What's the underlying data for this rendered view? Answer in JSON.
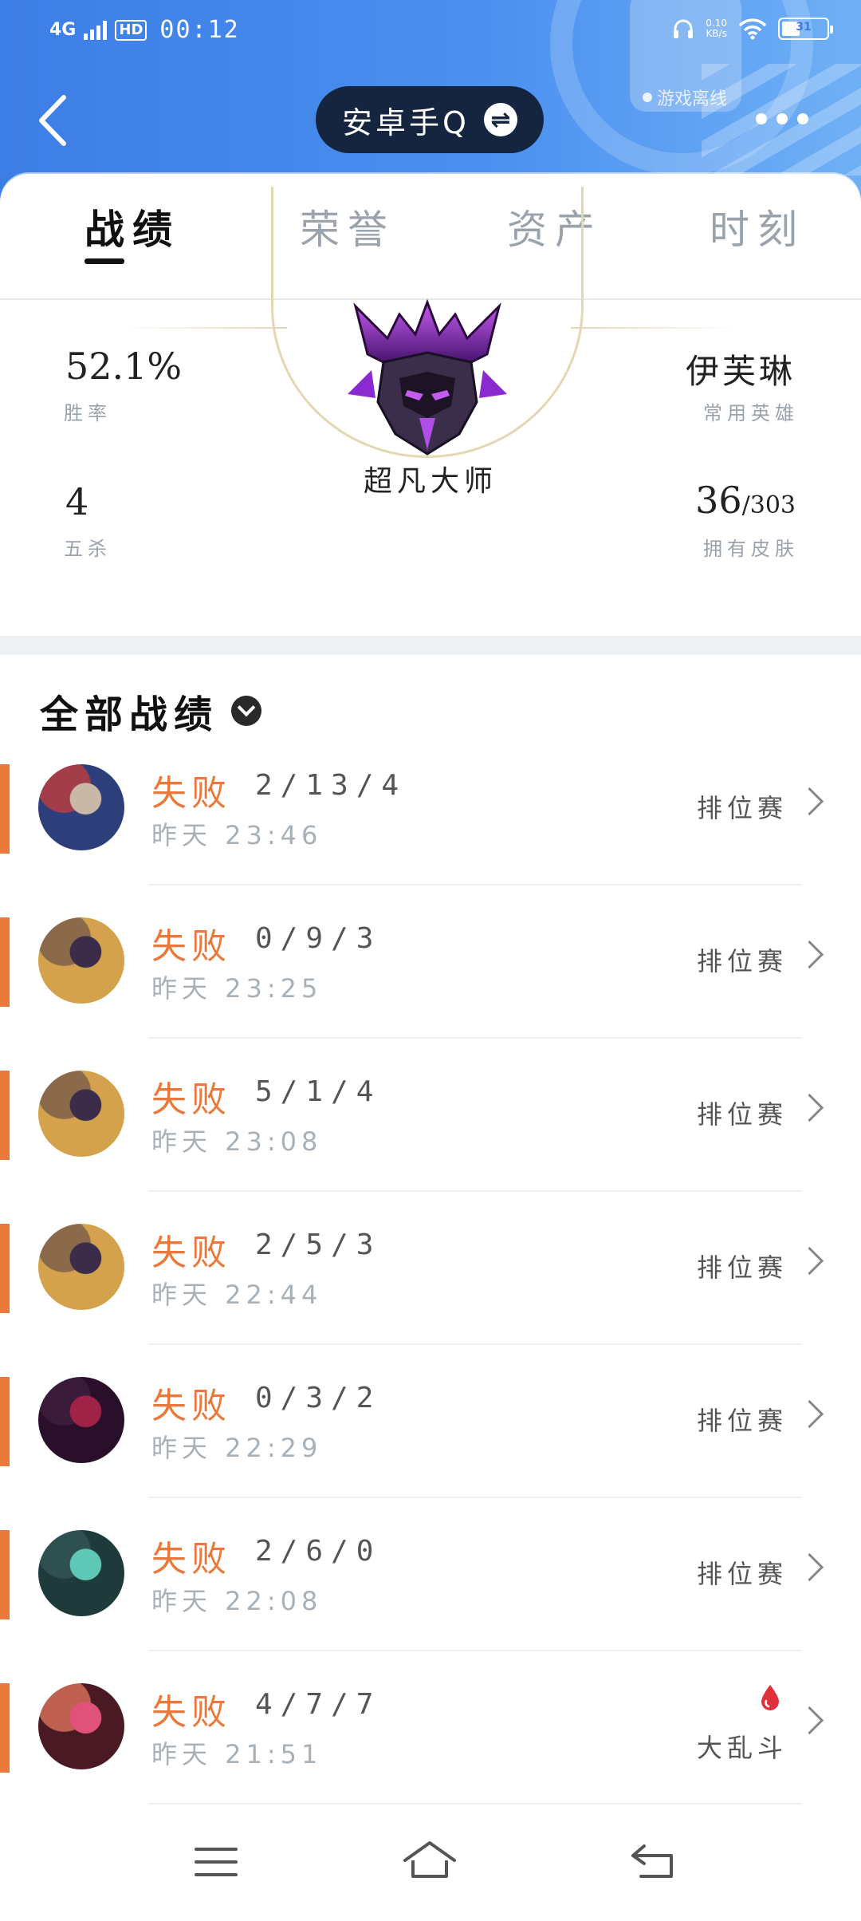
{
  "status_bar": {
    "network": "4G",
    "hd": "HD",
    "time": "00:12",
    "net_speed": "0.10\nKB/s",
    "battery": "31"
  },
  "header": {
    "account_name": "安卓手Q",
    "offline_label": "游戏离线",
    "swap_icon": "⇌"
  },
  "tabs": [
    {
      "label": "战绩",
      "active": true
    },
    {
      "label": "荣誉",
      "active": false
    },
    {
      "label": "资产",
      "active": false
    },
    {
      "label": "时刻",
      "active": false
    }
  ],
  "stats": {
    "win_rate": {
      "value": "52.1%",
      "label": "胜率"
    },
    "pentakills": {
      "value": "4",
      "label": "五杀"
    },
    "common_hero": {
      "value": "伊芙琳",
      "label": "常用英雄"
    },
    "skins": {
      "value": "36",
      "total": "/303",
      "label": "拥有皮肤"
    },
    "rank": "超凡大师"
  },
  "records": {
    "title": "全部战绩",
    "matches": [
      {
        "result": "失败",
        "kda": "2/13/4",
        "time": "昨天 23:46",
        "mode": "排位赛",
        "avatar_colors": [
          "#2d3f7a",
          "#c9b8a8",
          "#a33d4a"
        ]
      },
      {
        "result": "失败",
        "kda": "0/9/3",
        "time": "昨天 23:25",
        "mode": "排位赛",
        "avatar_colors": [
          "#d4a24c",
          "#3b2c4a",
          "#8a6a4a"
        ]
      },
      {
        "result": "失败",
        "kda": "5/1/4",
        "time": "昨天 23:08",
        "mode": "排位赛",
        "avatar_colors": [
          "#d4a24c",
          "#3b2c4a",
          "#8a6a4a"
        ]
      },
      {
        "result": "失败",
        "kda": "2/5/3",
        "time": "昨天 22:44",
        "mode": "排位赛",
        "avatar_colors": [
          "#d4a24c",
          "#3b2c4a",
          "#8a6a4a"
        ]
      },
      {
        "result": "失败",
        "kda": "0/3/2",
        "time": "昨天 22:29",
        "mode": "排位赛",
        "avatar_colors": [
          "#2a0f2a",
          "#a02246",
          "#3a1c3a"
        ]
      },
      {
        "result": "失败",
        "kda": "2/6/0",
        "time": "昨天 22:08",
        "mode": "排位赛",
        "avatar_colors": [
          "#1e3a3a",
          "#5fc7b5",
          "#2f5050"
        ]
      },
      {
        "result": "失败",
        "kda": "4/7/7",
        "time": "昨天 21:51",
        "mode": "大乱斗",
        "avatar_colors": [
          "#4a1a24",
          "#e0527a",
          "#c06050"
        ]
      }
    ]
  },
  "colors": {
    "accent_orange": "#e8793a",
    "header_blue": "#3d7ee6",
    "pill_dark": "#15253f",
    "rank_purple": "#7a2bbf"
  }
}
